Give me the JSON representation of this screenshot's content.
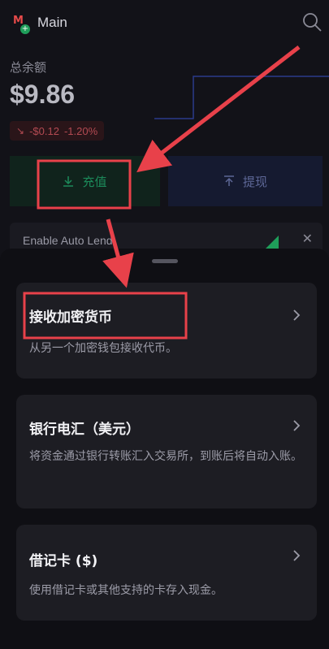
{
  "header": {
    "account_name": "Main",
    "logo_letter": "M"
  },
  "balance": {
    "label": "总余额",
    "value": "$9.86",
    "change": "-$0.12",
    "change_pct": "-1.20%"
  },
  "actions": {
    "deposit_label": "充值",
    "withdraw_label": "提现"
  },
  "auto_lend": {
    "label": "Enable Auto Lend"
  },
  "options": [
    {
      "title": "接收加密货币",
      "desc": "从另一个加密钱包接收代币。"
    },
    {
      "title": "银行电汇（美元）",
      "desc": "将资金通过银行转账汇入交易所，到账后将自动入账。"
    },
    {
      "title": "借记卡 ($)",
      "desc": "使用借记卡或其他支持的卡存入现金。"
    }
  ],
  "colors": {
    "highlight": "#e8414a",
    "positive": "#1f9e5a",
    "negative": "#b34a52"
  }
}
